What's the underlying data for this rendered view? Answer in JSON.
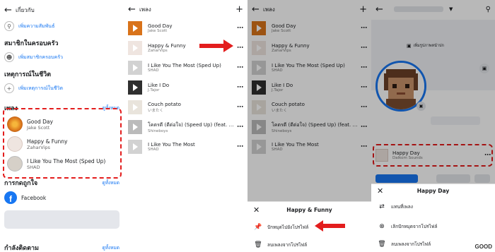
{
  "p1": {
    "back_label": "เกี่ยวกับ",
    "rel_add": "เพิ่มความสัมพันธ์",
    "family_title": "สมาชิกในครอบครัว",
    "family_add": "เพิ่มสมาชิกครอบครัว",
    "life_title": "เหตุการณ์ในชีวิต",
    "life_add": "เพิ่มเหตุการณ์ในชีวิต",
    "music_title": "เพลง",
    "see_all": "ดูทั้งหมด",
    "songs": [
      {
        "title": "Good Day",
        "artist": "Jake Scott"
      },
      {
        "title": "Happy & Funny",
        "artist": "ZaharVips"
      },
      {
        "title": "I Like You The Most (Sped Up)",
        "artist": "SHAD"
      }
    ],
    "likes_title": "การกดถูกใจ",
    "likes_see_all": "ดูทั้งหมด",
    "likes_item": "Facebook",
    "following_title": "กำลังติดตาม",
    "following_see_all": "ดูทั้งหมด"
  },
  "p2": {
    "title": "เพลง",
    "songs": [
      {
        "title": "Good Day",
        "artist": "Jake Scott"
      },
      {
        "title": "Happy & Funny",
        "artist": "ZaharVips"
      },
      {
        "title": "I Like You The Most (Sped Up)",
        "artist": "SHAD"
      },
      {
        "title": "Like I Do",
        "artist": "J.Tajor"
      },
      {
        "title": "Couch potato",
        "artist": "いまたく"
      },
      {
        "title": "โคตรดี (ดีต่อใจ) (Speed Up) (feat. the...",
        "artist": "Shineboys"
      },
      {
        "title": "I Like You The Most",
        "artist": "SHAD"
      }
    ]
  },
  "p3": {
    "title": "เพลง",
    "sheet_title": "Happy & Funny",
    "pin_label": "ปักหมุดไปยังโปรไฟล์",
    "remove_label": "ลบเพลงจากโปรไฟล์"
  },
  "p4": {
    "cover_label": "เพิ่มรูปภาพหน้าปก",
    "song_title": "Happy Day",
    "song_artist": "Dalkom Sounds",
    "sheet_title": "Happy Day",
    "opt1": "แทนที่เพลง",
    "opt2": "เลิกปักหมุดจากโปรไฟล์",
    "opt3": "ลบเพลงจากโปรไฟล์",
    "watermark": "GOOD"
  },
  "colors": {
    "accent": "#1877f2",
    "red": "#e31d1d"
  }
}
